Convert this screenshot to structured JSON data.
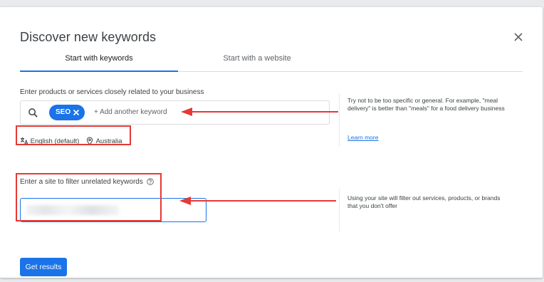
{
  "dialog": {
    "title": "Discover new keywords",
    "tabs": [
      {
        "label": "Start with keywords",
        "active": true
      },
      {
        "label": "Start with a website",
        "active": false
      }
    ]
  },
  "keywords": {
    "label": "Enter products or services closely related to your business",
    "chips": [
      {
        "label": "SEO"
      }
    ],
    "placeholder": "+ Add another keyword",
    "language": "English (default)",
    "location": "Australia",
    "help_text": "Try not to be too specific or general. For example, \"meal delivery\" is better than \"meals\" for a food delivery business",
    "learn_more": "Learn more"
  },
  "site": {
    "label": "Enter a site to filter unrelated keywords",
    "help_text": "Using your site will filter out services, products, or brands that you don't offer"
  },
  "actions": {
    "get_results": "Get results"
  },
  "icons": {
    "close": "close-icon",
    "search": "search-icon",
    "chip_remove": "close-icon",
    "language": "translate-icon",
    "location": "location-pin-icon",
    "help": "help-circle-icon"
  },
  "colors": {
    "accent": "#1a73e8",
    "annotation": "#e53935"
  }
}
